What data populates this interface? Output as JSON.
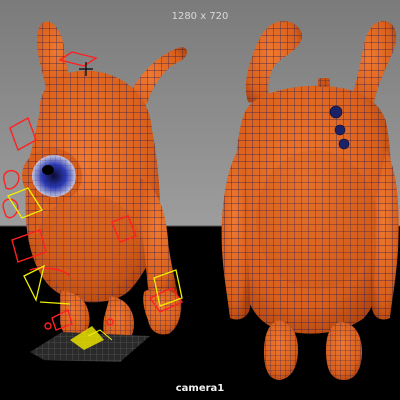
{
  "viewport": {
    "resolution_gate_label": "1280 x 720",
    "camera_name": "camera1"
  },
  "colors": {
    "background_top": "#7a7a7a",
    "background_horizon": "#9a9a9a",
    "mesh_fill": "#e0651c",
    "mesh_shadow": "#a63c0b",
    "wireframe": "#2a1a52",
    "selection_handles": "#ff2020",
    "guide_yellow": "#f0f000",
    "eye_blue": "#1c2a9a"
  },
  "icons": {
    "ground_grid": "ground-grid-icon",
    "manipulator": "crosshair-icon"
  }
}
